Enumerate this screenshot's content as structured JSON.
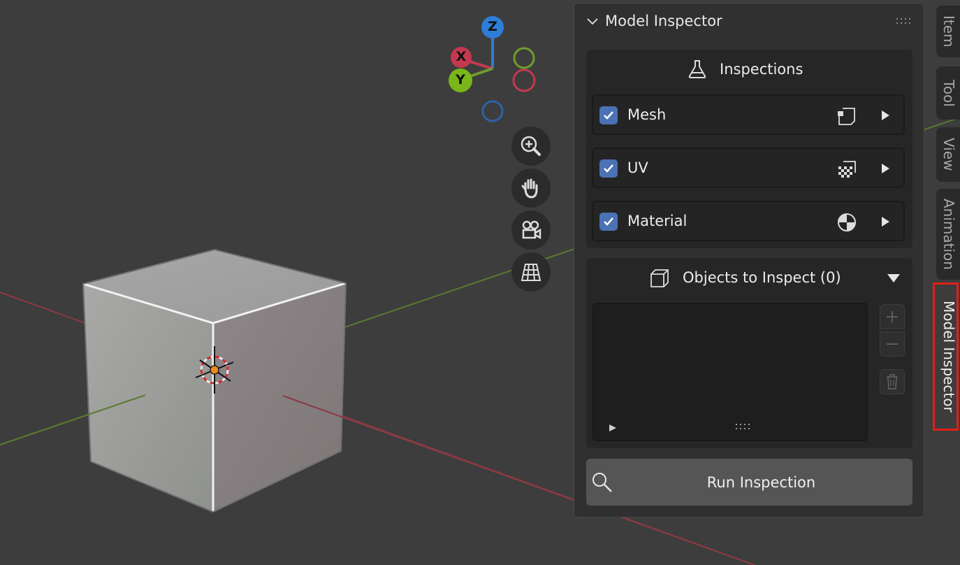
{
  "gizmo": {
    "z_label": "Z",
    "x_label": "X",
    "y_label": "Y"
  },
  "nav_buttons": [
    "zoom-icon",
    "hand-pan-icon",
    "camera-icon",
    "grid-ortho-icon"
  ],
  "panel": {
    "title": "Model Inspector",
    "inspections": {
      "title": "Inspections",
      "items": [
        {
          "label": "Mesh",
          "checked": true,
          "icon": "mesh-icon"
        },
        {
          "label": "UV",
          "checked": true,
          "icon": "uv-checker-icon"
        },
        {
          "label": "Material",
          "checked": true,
          "icon": "material-sphere-icon"
        }
      ]
    },
    "objects": {
      "title": "Objects to Inspect (0)",
      "items": []
    },
    "run_button": "Run Inspection"
  },
  "tabs": [
    "Item",
    "Tool",
    "View",
    "Animation",
    "Model Inspector"
  ],
  "active_tab": "Model Inspector",
  "colors": {
    "x_axis": "#c4394f",
    "y_axis": "#6d9e2c",
    "z_axis": "#2e7dd7",
    "checkbox": "#4a72b4",
    "highlight": "#e0201a"
  }
}
